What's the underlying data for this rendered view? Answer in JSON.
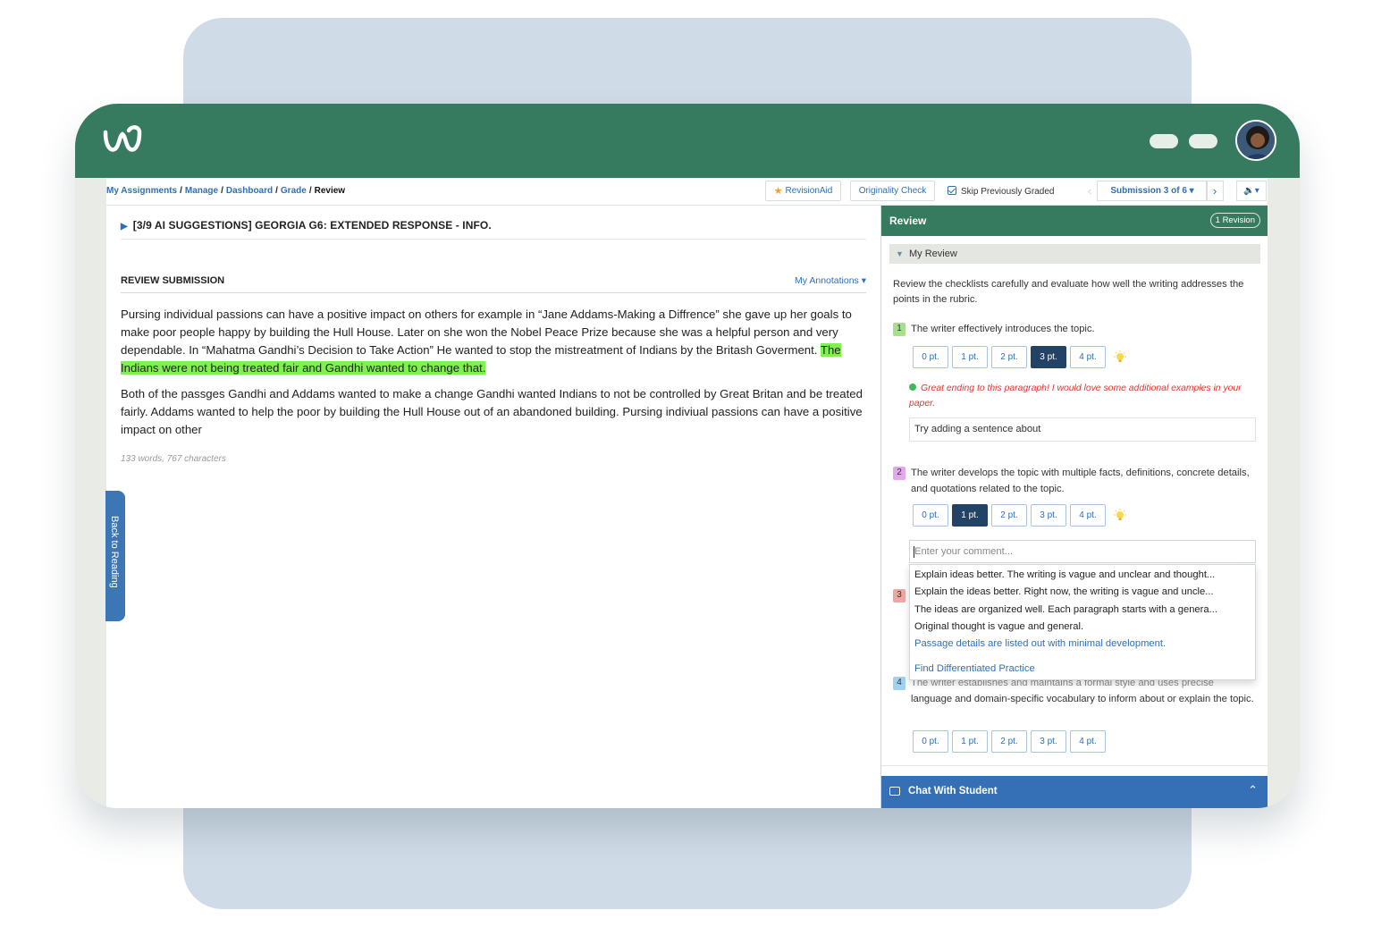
{
  "breadcrumb": {
    "items": [
      "My Assignments",
      "Manage",
      "Dashboard",
      "Grade"
    ],
    "current": "Review",
    "separator": "/"
  },
  "toolbar": {
    "revisionaid": "RevisionAid",
    "originality": "Originality Check",
    "skip_graded": "Skip Previously Graded",
    "submission": "Submission 3 of 6 ▾",
    "prev": "‹",
    "next": "›",
    "audio": "🔉▾"
  },
  "assignment": {
    "title": "[3/9 AI SUGGESTIONS] GEORGIA G6: EXTENDED RESPONSE - INFO."
  },
  "submission": {
    "heading": "REVIEW SUBMISSION",
    "annotations": "My Annotations ▾",
    "p1_a": "Pursing individual passions can have a positive impact on others for example in “Jane Addams-Making a Diffrence” she gave up her goals to make poor people happy by building the Hull House. Later on she won the Nobel Peace Prize because she was a helpful person and very dependable. In “Mahatma Gandhi’s Decision to Take Action” He wanted to stop the mistreatment of Indians by the Britash Goverment. ",
    "p1_highlight": "The Indians were not being treated fair and Gandhi wanted to change that.",
    "p2": "Both of the passges Gandhi and Addams wanted to make a change Gandhi wanted Indians to not be controlled by Great Britan and be treated fairly. Addams wanted to help the poor by building the Hull House out of an abandoned building. Pursing indiviual passions can have a positive impact on other",
    "word_count": "133 words, 767 characters"
  },
  "back_tab": "Back to Reading",
  "review": {
    "title": "Review",
    "revision_badge": "1 Revision",
    "section": "My Review",
    "intro": "Review the checklists carefully and evaluate how well the writing addresses the points in the rubric.",
    "point_labels": [
      "0 pt.",
      "1 pt.",
      "2 pt.",
      "3 pt.",
      "4 pt."
    ],
    "criteria": [
      {
        "number": "1",
        "color": "#a6e08d",
        "text": "The writer effectively introduces the topic.",
        "selected": "3 pt."
      },
      {
        "number": "2",
        "color": "#e2a7ec",
        "text": "The writer develops the topic with multiple facts, definitions, concrete details, and quotations related to the topic.",
        "selected": "1 pt."
      },
      {
        "number": "3",
        "color": "#f0a7a3"
      },
      {
        "number": "4",
        "color": "#9fd2f0",
        "text_hidden": "The writer establishes and maintains a formal style and uses precise",
        "text": "language and domain-specific vocabulary to inform about or explain the topic."
      }
    ],
    "feedback": "Great ending to this paragraph! I would love some additional examples in your paper.",
    "comment1": "Try adding a sentence about",
    "comment_placeholder": "Enter your comment...",
    "suggestions": [
      "Explain ideas better. The writing is vague and unclear and thought...",
      "Explain the ideas better. Right now, the writing is vague and uncle...",
      "The ideas are organized well. Each paragraph starts with a genera...",
      "Original thought is vague and general.",
      "Passage details are listed out with minimal development."
    ],
    "find_practice": "Find Differentiated Practice",
    "chat": "Chat With Student",
    "chat_chevron": "⌃"
  },
  "colors": {
    "header_green": "#367b5f",
    "link_blue": "#2f6fb8",
    "selected_point": "#234366",
    "highlight": "#7fef52",
    "chat_bar": "#3570b7"
  },
  "icons": [
    "logo-icon",
    "star-icon",
    "checkbox-icon",
    "speaker-icon",
    "lightbulb-icon",
    "chat-icon",
    "chevron-up-icon",
    "avatar"
  ]
}
